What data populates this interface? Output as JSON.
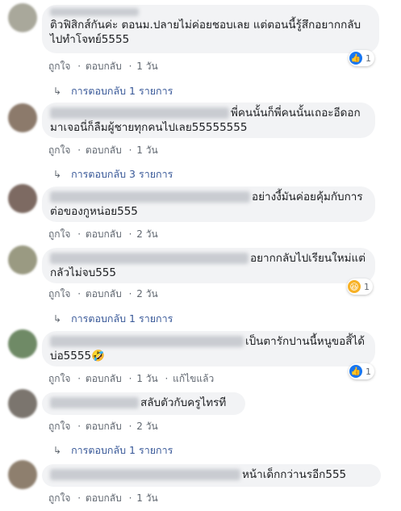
{
  "comments": [
    {
      "text": "ติวฟิสิกส์กันค่ะ ตอนม.ปลายไม่ค่อยชอบเลย แต่ตอนนี้รู้สึกอยากกลับไปทำโจทย์5555",
      "like": "ถูกใจ",
      "reply": "ตอบกลับ",
      "time": "1 วัน",
      "reaction_count": "1",
      "reaction_type": "like",
      "replies": "การตอบกลับ 1 รายการ"
    },
    {
      "text": "พี่คนนั้นก็พี่คนนั้นเถอะอีดอกมาเจอนี่ก็ลืมผู้ชายทุกคนไปเลย55555555",
      "like": "ถูกใจ",
      "reply": "ตอบกลับ",
      "time": "1 วัน",
      "replies": "การตอบกลับ 3 รายการ"
    },
    {
      "text": "อย่างงี้มันค่อยคุ้มกับการต่อของกูหน่อย555",
      "like": "ถูกใจ",
      "reply": "ตอบกลับ",
      "time": "2 วัน"
    },
    {
      "text": "อยากกลับไปเรียนใหม่แต่กลัวไม่จบ555",
      "like": "ถูกใจ",
      "reply": "ตอบกลับ",
      "time": "2 วัน",
      "reaction_count": "1",
      "reaction_type": "haha",
      "replies": "การตอบกลับ 1 รายการ"
    },
    {
      "text": "เป็นตารักปานนี้หนูขอสิ้ได้บ่อ5555🤣",
      "like": "ถูกใจ",
      "reply": "ตอบกลับ",
      "time": "1 วัน",
      "edited": "แก้ไขแล้ว",
      "reaction_count": "1",
      "reaction_type": "like"
    },
    {
      "text": "สลับตัวกับครูไทรที",
      "like": "ถูกใจ",
      "reply": "ตอบกลับ",
      "time": "2 วัน",
      "replies": "การตอบกลับ 1 รายการ"
    },
    {
      "text": "หน้าเด็กกว่านรอีก555",
      "like": "ถูกใจ",
      "reply": "ตอบกลับ",
      "time": "1 วัน"
    }
  ],
  "separator": "·",
  "reply_arrow_icon": "reply-arrow-icon",
  "colors": {
    "link": "#385898",
    "bubble": "#f2f3f5",
    "like": "#1877f2"
  }
}
